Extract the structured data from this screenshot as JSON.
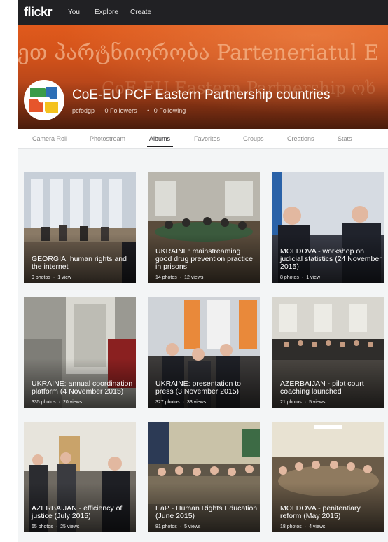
{
  "nav": {
    "logo": "flickr",
    "links": [
      "You",
      "Explore",
      "Create"
    ]
  },
  "profile": {
    "banner_text_line1": "ეთ პარტნიორობა Parteneriatul E",
    "banner_text_line2": "CoE-EU Eastern Partnership ოხ",
    "name": "CoE-EU PCF Eastern Partnership countries",
    "username": "pcfodgp",
    "followers": "0 Followers",
    "following": "0 Following",
    "avatar_colors": [
      "#e6552b",
      "#3a9b49",
      "#2d6fb6",
      "#f4c21e"
    ]
  },
  "tabs": [
    "Camera Roll",
    "Photostream",
    "Albums",
    "Favorites",
    "Groups",
    "Creations",
    "Stats"
  ],
  "active_tab": "Albums",
  "albums": [
    {
      "title": "GEORGIA: human rights and the internet",
      "photos": "9 photos",
      "views": "1 view"
    },
    {
      "title": "UKRAINE: mainstreaming good drug prevention practice in prisons",
      "photos": "14 photos",
      "views": "12 views"
    },
    {
      "title": "MOLDOVA - workshop on judicial statistics (24 November 2015)",
      "photos": "8 photos",
      "views": "1 view"
    },
    {
      "title": "UKRAINE: annual coordination platform (4 November 2015)",
      "photos": "335 photos",
      "views": "20 views"
    },
    {
      "title": "UKRAINE: presentation to press (3 November 2015)",
      "photos": "327 photos",
      "views": "33 views"
    },
    {
      "title": "AZERBAIJAN - pilot court coaching launched",
      "photos": "21 photos",
      "views": "5 views"
    },
    {
      "title": "AZERBAIJAN - efficiency of justice (July 2015)",
      "photos": "65 photos",
      "views": "25 views"
    },
    {
      "title": "EaP - Human Rights Education (June 2015)",
      "photos": "81 photos",
      "views": "5 views"
    },
    {
      "title": "MOLDOVA - penitentiary reform (May 2015)",
      "photos": "18 photos",
      "views": "4 views"
    }
  ],
  "colors": {
    "topnav": "#212124",
    "banner": "#d2521a",
    "page_bg": "#f3f5f6"
  }
}
